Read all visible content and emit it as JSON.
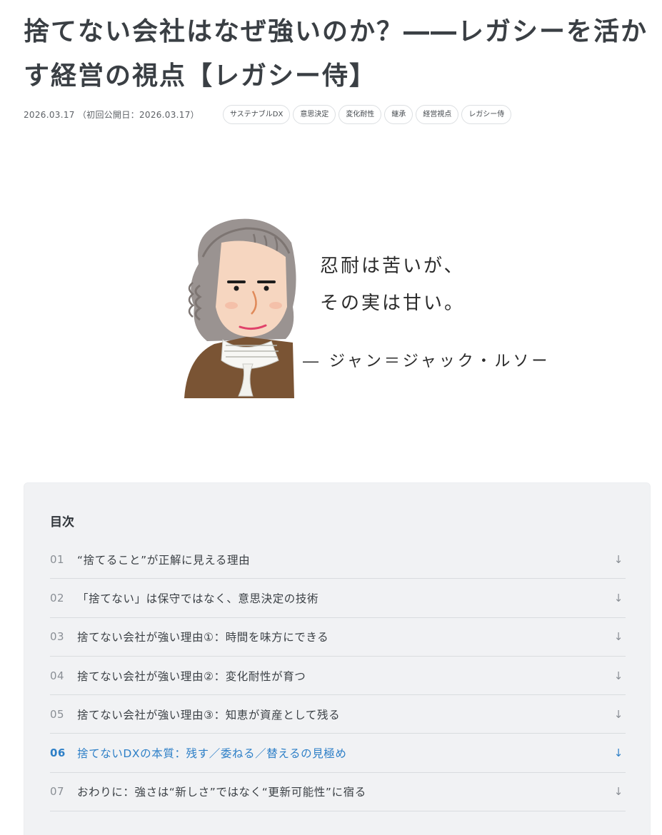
{
  "article": {
    "title": "捨てない会社はなぜ強いのか？――レガシーを活かす経営の視点【レガシー侍】",
    "date": "2026.03.17",
    "first_published": "（初回公開日：2026.03.17）",
    "tags": [
      "サステナブルDX",
      "意思決定",
      "変化耐性",
      "継承",
      "経営視点",
      "レガシー侍"
    ]
  },
  "figure": {
    "quote_line1": "忍耐は苦いが、",
    "quote_line2": "その実は甘い。",
    "attribution": "― ジャン＝ジャック・ルソー"
  },
  "toc": {
    "heading": "目次",
    "active_index": 5,
    "items": [
      {
        "num": "01",
        "text": "“捨てること”が正解に見える理由",
        "arrow": "↓"
      },
      {
        "num": "02",
        "text": "「捨てない」は保守ではなく、意思決定の技術",
        "arrow": "↓"
      },
      {
        "num": "03",
        "text": "捨てない会社が強い理由①：時間を味方にできる",
        "arrow": "↓"
      },
      {
        "num": "04",
        "text": "捨てない会社が強い理由②：変化耐性が育つ",
        "arrow": "↓"
      },
      {
        "num": "05",
        "text": "捨てない会社が強い理由③：知恵が資産として残る",
        "arrow": "↓"
      },
      {
        "num": "06",
        "text": "捨てないDXの本質：残す／委ねる／替えるの見極め",
        "arrow": "↓"
      },
      {
        "num": "07",
        "text": "おわりに：強さは“新しさ”ではなく“更新可能性”に宿る",
        "arrow": "↓"
      }
    ]
  },
  "colors": {
    "active": "#2d7fc7",
    "toc_background": "#f1f2f4",
    "title": "#3a3f44"
  }
}
